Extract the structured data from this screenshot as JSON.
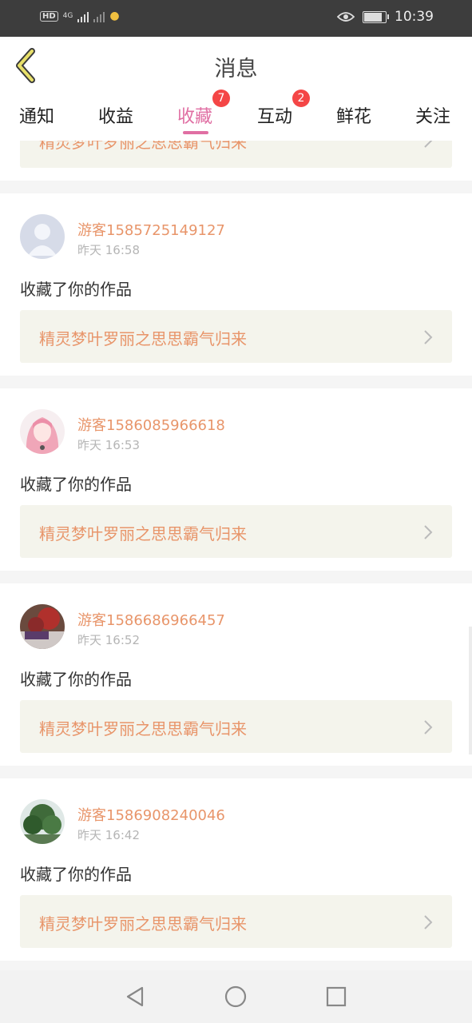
{
  "status_bar": {
    "hd": "HD",
    "net": "4G",
    "time": "10:39",
    "icons": [
      "hd-icon",
      "signal-icon",
      "no-signal-icon",
      "notification-icon",
      "eye-icon",
      "battery-icon"
    ]
  },
  "header": {
    "title": "消息",
    "back_icon": "back-chevron-icon"
  },
  "tabs": [
    {
      "label": "通知"
    },
    {
      "label": "收益"
    },
    {
      "label": "收藏",
      "badge": "7",
      "active": true
    },
    {
      "label": "互动",
      "badge": "2"
    },
    {
      "label": "鲜花"
    },
    {
      "label": "关注"
    }
  ],
  "colors": {
    "accent": "#e06fa3",
    "name": "#e8956a",
    "badge": "#f44646",
    "work_bg": "#f4f4ec"
  },
  "partial_item": {
    "work_title": "精灵梦叶罗丽之思思霸气归来"
  },
  "items": [
    {
      "user": "游客1585725149127",
      "time": "昨天 16:58",
      "action": "收藏了你的作品",
      "work_title": "精灵梦叶罗丽之思思霸气归来",
      "avatar": "default-avatar"
    },
    {
      "user": "游客1586085966618",
      "time": "昨天 16:53",
      "action": "收藏了你的作品",
      "work_title": "精灵梦叶罗丽之思思霸气归来",
      "avatar": "anime-girl-avatar"
    },
    {
      "user": "游客1586686966457",
      "time": "昨天 16:52",
      "action": "收藏了你的作品",
      "work_title": "精灵梦叶罗丽之思思霸气归来",
      "avatar": "photo-avatar"
    },
    {
      "user": "游客1586908240046",
      "time": "昨天 16:42",
      "action": "收藏了你的作品",
      "work_title": "精灵梦叶罗丽之思思霸气归来",
      "avatar": "tree-avatar"
    }
  ],
  "nav": [
    "back-triangle-icon",
    "home-circle-icon",
    "recents-square-icon"
  ]
}
